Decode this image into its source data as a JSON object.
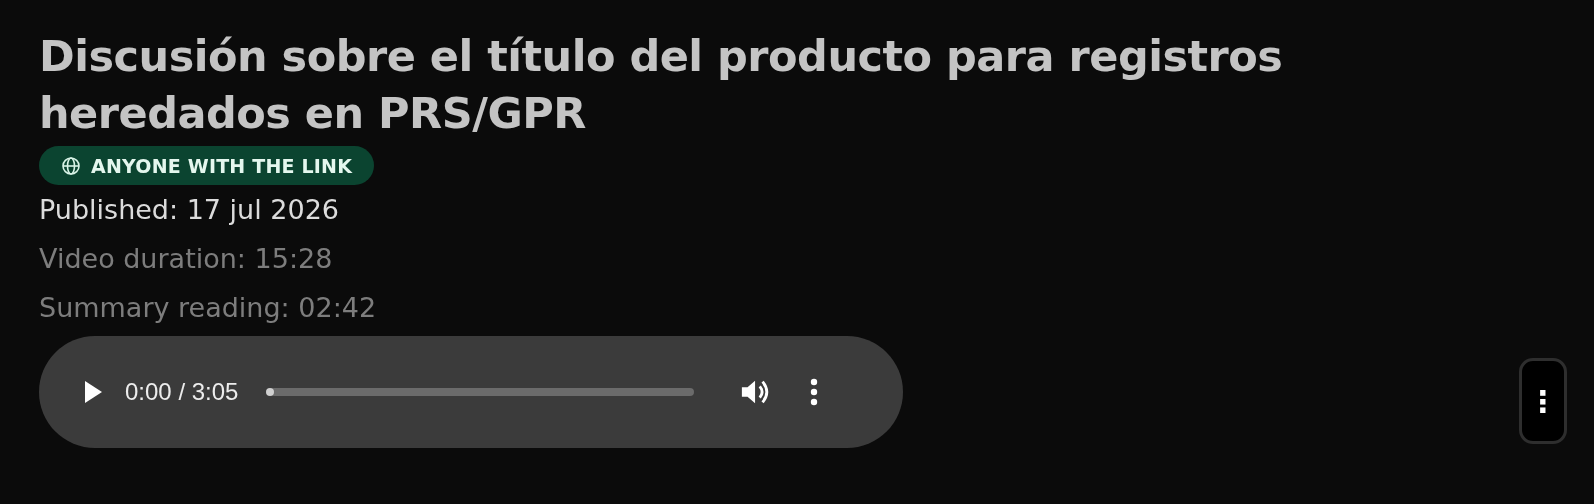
{
  "title": "Discusión sobre el título del producto para registros heredados en PRS/GPR",
  "visibility_badge": {
    "label": "ANYONE WITH THE LINK"
  },
  "meta": [
    {
      "text": "Published: 17 jul 2026",
      "kind": "primary"
    },
    {
      "text": "Video duration: 15:28",
      "kind": "secondary"
    },
    {
      "text": "Summary reading: 02:42",
      "kind": "secondary"
    }
  ],
  "audio_player": {
    "time": "0:00 / 3:05",
    "level": 0
  },
  "more_button": {
    "label": "⋮"
  }
}
